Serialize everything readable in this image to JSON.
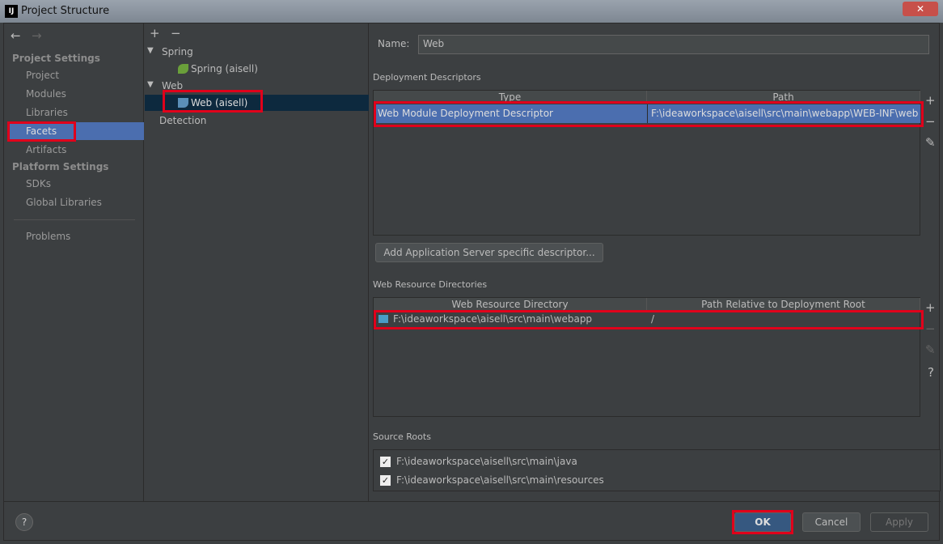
{
  "window": {
    "title": "Project Structure",
    "logo": "IJ",
    "close": "✕"
  },
  "nav": {
    "back": "←",
    "forward": "→"
  },
  "sidebar": {
    "project_settings": "Project Settings",
    "items": [
      "Project",
      "Modules",
      "Libraries",
      "Facets",
      "Artifacts"
    ],
    "platform_settings": "Platform Settings",
    "platform_items": [
      "SDKs",
      "Global Libraries"
    ],
    "problems": "Problems",
    "selected": "Facets"
  },
  "tree": {
    "add": "+",
    "remove": "−",
    "spring_group": "Spring",
    "spring_item": "Spring (aisell)",
    "web_group": "Web",
    "web_item": "Web (aisell)",
    "detection": "Detection"
  },
  "main": {
    "name_label": "Name:",
    "name_value": "Web",
    "deployment": {
      "title": "Deployment Descriptors",
      "columns": [
        "Type",
        "Path"
      ],
      "rows": [
        [
          "Web Module Deployment Descriptor",
          "F:\\ideaworkspace\\aisell\\src\\main\\webapp\\WEB-INF\\web."
        ]
      ],
      "add_server_button": "Add Application Server specific descriptor..."
    },
    "resources": {
      "title": "Web Resource Directories",
      "columns": [
        "Web Resource Directory",
        "Path Relative to Deployment Root"
      ],
      "rows": [
        [
          "F:\\ideaworkspace\\aisell\\src\\main\\webapp",
          "/"
        ]
      ]
    },
    "source_roots": {
      "title": "Source Roots",
      "items": [
        {
          "path": "F:\\ideaworkspace\\aisell\\src\\main\\java",
          "checked": true
        },
        {
          "path": "F:\\ideaworkspace\\aisell\\src\\main\\resources",
          "checked": true
        }
      ]
    },
    "side_tools": {
      "add": "+",
      "remove": "−",
      "edit": "✎",
      "help": "?"
    }
  },
  "footer": {
    "help": "?",
    "ok": "OK",
    "cancel": "Cancel",
    "apply": "Apply"
  },
  "colors": {
    "selection": "#4b6eaf",
    "tree_selection": "#0d293e",
    "annotation": "#e0001b"
  }
}
